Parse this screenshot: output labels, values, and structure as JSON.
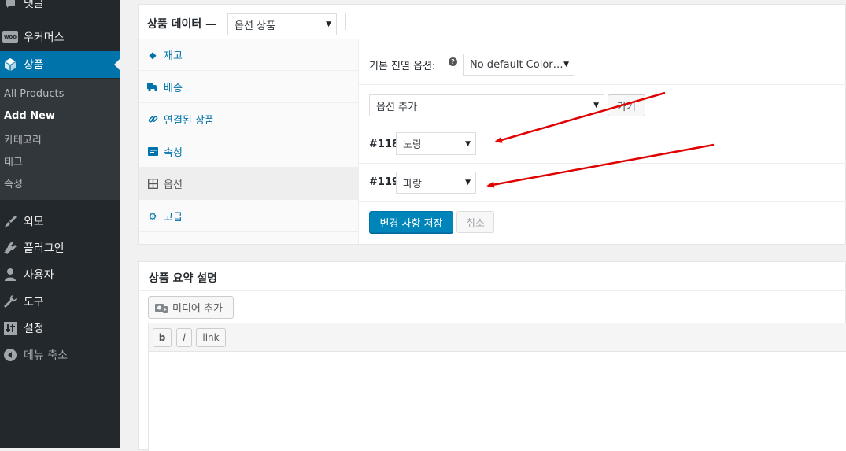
{
  "sidebar": {
    "items": [
      {
        "label": "댓글",
        "icon": "comment-icon"
      },
      {
        "label": "우커머스",
        "icon": "woocommerce-icon",
        "badge": "woo"
      },
      {
        "label": "상품",
        "icon": "product-box-icon",
        "current": true
      },
      {
        "label": "외모",
        "icon": "paintbrush-icon"
      },
      {
        "label": "플러그인",
        "icon": "plugin-icon"
      },
      {
        "label": "사용자",
        "icon": "user-icon"
      },
      {
        "label": "도구",
        "icon": "wrench-icon"
      },
      {
        "label": "설정",
        "icon": "settings-sliders-icon"
      },
      {
        "label": "메뉴 축소",
        "icon": "collapse-arrow-icon"
      }
    ],
    "submenu": [
      "All Products",
      "Add New",
      "카테고리",
      "태그",
      "속성"
    ],
    "active_submenu": "Add New"
  },
  "product_data": {
    "title": "상품 데이터 —",
    "type_select": "옵션 상품",
    "tabs": [
      {
        "label": "재고",
        "icon": "tag-diamond-icon"
      },
      {
        "label": "배송",
        "icon": "truck-icon"
      },
      {
        "label": "연결된 상품",
        "icon": "link-icon"
      },
      {
        "label": "속성",
        "icon": "list-card-icon"
      },
      {
        "label": "옵션",
        "icon": "grid-icon",
        "active": true
      },
      {
        "label": "고급",
        "icon": "gear-icon"
      }
    ],
    "default_label": "기본 진열 옵션:",
    "default_select": "No default Color…",
    "add_variation_select": "옵션 추가",
    "go_button": "가기",
    "variations": [
      {
        "id": "#118",
        "value": "노랑"
      },
      {
        "id": "#119",
        "value": "파랑"
      }
    ],
    "save_button": "변경 사항 저장",
    "cancel_button": "취소"
  },
  "short_description": {
    "title": "상품 요약 설명",
    "add_media": "미디어 추가",
    "toolbar": [
      "b",
      "i",
      "link"
    ]
  },
  "colors": {
    "sidebar_bg": "#23282d",
    "submenu_bg": "#32373c",
    "accent": "#0073aa",
    "primary_button": "#0085ba",
    "annotation_arrow": "#e00000"
  }
}
